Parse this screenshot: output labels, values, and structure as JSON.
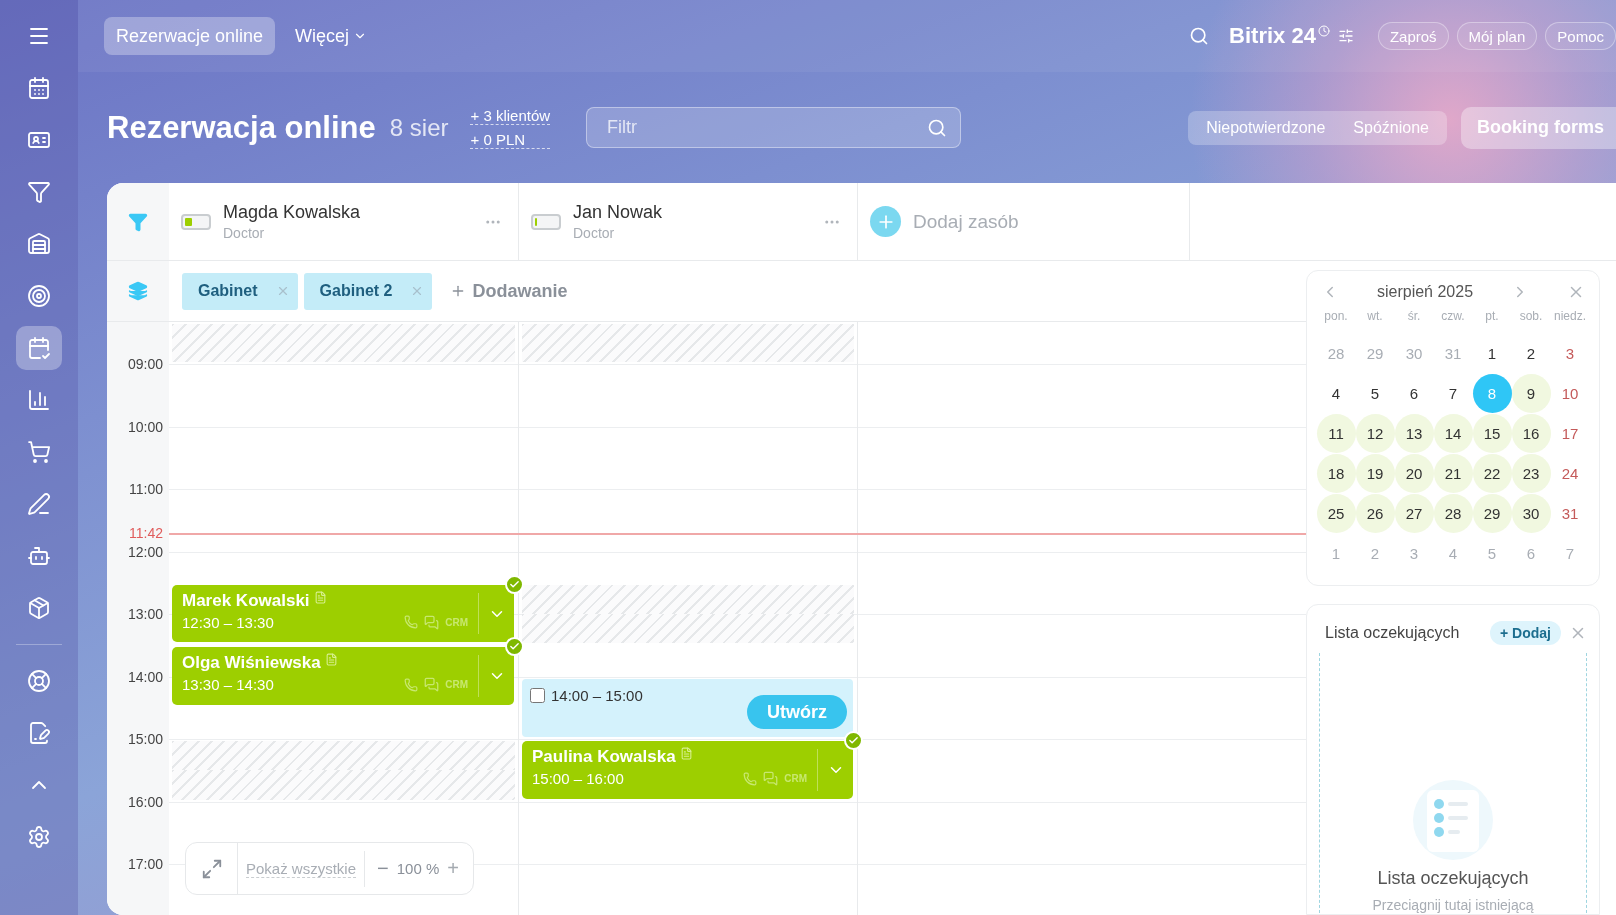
{
  "sidebar": {
    "items": [
      {
        "selected": false
      },
      {
        "selected": false
      },
      {
        "selected": false
      },
      {
        "selected": false
      },
      {
        "selected": false
      },
      {
        "selected": false
      },
      {
        "selected": true
      },
      {
        "selected": false
      },
      {
        "selected": false
      },
      {
        "selected": false
      },
      {
        "selected": false
      },
      {
        "selected": false
      },
      {
        "selected": false
      },
      {
        "selected": false
      },
      {
        "selected": false
      },
      {
        "selected": false
      }
    ]
  },
  "topbar": {
    "tabs": [
      {
        "label": "Rezerwacje online",
        "selected": true
      },
      {
        "label": "Więcej",
        "selected": false
      }
    ],
    "logo": "Bitrix 24",
    "buttons": [
      "Zaproś",
      "Mój plan",
      "Pomoc"
    ]
  },
  "header": {
    "title": "Rezerwacja online",
    "date": "8 sier",
    "stats": [
      "+ 3 klientów",
      "+ 0 PLN"
    ],
    "filter": {
      "placeholder": "Filtr"
    },
    "segments": [
      {
        "label": "Niepotwierdzone",
        "selected": false
      },
      {
        "label": "Spóźnione",
        "selected": false
      }
    ],
    "forms_button": "Booking forms"
  },
  "resources": [
    {
      "name": "Magda Kowalska",
      "role": "Doctor",
      "level": 0.3,
      "slots": [
        {
          "blocked": true
        },
        {
          "blocked": false
        },
        {
          "blocked": false
        },
        {
          "blocked": false
        },
        {
          "blocked": false
        },
        {
          "blocked": false
        },
        {
          "blocked": false
        },
        {
          "blocked": false
        },
        {
          "blocked": false
        },
        {
          "blocked": false
        },
        {
          "blocked": false
        },
        {
          "blocked": false
        },
        {
          "blocked": false
        },
        {
          "blocked": true
        },
        {
          "blocked": true
        },
        {
          "blocked": false
        },
        {
          "blocked": false
        },
        {
          "blocked": false
        },
        {
          "blocked": false
        }
      ],
      "events": [
        {
          "kind": "booking",
          "name": "Marek Kowalski",
          "time": "12:30 – 13:30",
          "crm": "CRM",
          "confirmed": true
        },
        {
          "kind": "booking",
          "name": "Olga Wiśniewska",
          "time": "13:30 – 14:30",
          "crm": "CRM",
          "confirmed": true
        }
      ]
    },
    {
      "name": "Jan Nowak",
      "role": "Doctor",
      "level": 0.08,
      "slots": [
        {
          "blocked": true
        },
        {
          "blocked": false
        },
        {
          "blocked": false
        },
        {
          "blocked": false
        },
        {
          "blocked": false
        },
        {
          "blocked": false
        },
        {
          "blocked": false
        },
        {
          "blocked": false
        },
        {
          "blocked": true
        },
        {
          "blocked": true
        },
        {
          "blocked": false
        },
        {
          "blocked": false
        },
        {
          "blocked": false
        },
        {
          "blocked": false
        },
        {
          "blocked": false
        },
        {
          "blocked": false
        },
        {
          "blocked": false
        },
        {
          "blocked": false
        },
        {
          "blocked": false
        }
      ],
      "events": [
        {
          "kind": "draft",
          "time": "14:00 – 15:00",
          "checked": false,
          "action": "Utwórz"
        },
        {
          "kind": "booking",
          "name": "Paulina Kowalska",
          "time": "15:00 – 16:00",
          "crm": "CRM",
          "confirmed": true
        }
      ]
    }
  ],
  "add_resource": "Dodaj zasób",
  "tags": [
    "Gabinet",
    "Gabinet 2"
  ],
  "add_tag": "Dodawanie",
  "hours": [
    "09:00",
    "10:00",
    "11:00",
    "12:00",
    "13:00",
    "14:00",
    "15:00",
    "16:00",
    "17:00"
  ],
  "now": "11:42",
  "zoom": {
    "show_all": "Pokaż wszystkie",
    "minus": "−",
    "value": "100 %",
    "plus": "+"
  },
  "calendar": {
    "month": "sierpień 2025",
    "weekdays": [
      "pon.",
      "wt.",
      "śr.",
      "czw.",
      "pt.",
      "sob.",
      "niedz."
    ],
    "weeks": [
      [
        {
          "label": "28",
          "kind": "other",
          "available": false,
          "selected": false
        },
        {
          "label": "29",
          "kind": "other",
          "available": false,
          "selected": false
        },
        {
          "label": "30",
          "kind": "other",
          "available": false,
          "selected": false
        },
        {
          "label": "31",
          "kind": "other",
          "available": false,
          "selected": false
        },
        {
          "label": "1",
          "kind": "day",
          "available": false,
          "selected": false
        },
        {
          "label": "2",
          "kind": "day",
          "available": false,
          "selected": false
        },
        {
          "label": "3",
          "kind": "sunday",
          "available": false,
          "selected": false
        }
      ],
      [
        {
          "label": "4",
          "kind": "day",
          "available": false,
          "selected": false
        },
        {
          "label": "5",
          "kind": "day",
          "available": false,
          "selected": false
        },
        {
          "label": "6",
          "kind": "day",
          "available": false,
          "selected": false
        },
        {
          "label": "7",
          "kind": "day",
          "available": false,
          "selected": false
        },
        {
          "label": "8",
          "kind": "day",
          "available": false,
          "selected": true
        },
        {
          "label": "9",
          "kind": "day",
          "available": true,
          "selected": false
        },
        {
          "label": "10",
          "kind": "sunday",
          "available": false,
          "selected": false
        }
      ],
      [
        {
          "label": "11",
          "kind": "day",
          "available": true,
          "selected": false
        },
        {
          "label": "12",
          "kind": "day",
          "available": true,
          "selected": false
        },
        {
          "label": "13",
          "kind": "day",
          "available": true,
          "selected": false
        },
        {
          "label": "14",
          "kind": "day",
          "available": true,
          "selected": false
        },
        {
          "label": "15",
          "kind": "day",
          "available": true,
          "selected": false
        },
        {
          "label": "16",
          "kind": "day",
          "available": true,
          "selected": false
        },
        {
          "label": "17",
          "kind": "sunday",
          "available": false,
          "selected": false
        }
      ],
      [
        {
          "label": "18",
          "kind": "day",
          "available": true,
          "selected": false
        },
        {
          "label": "19",
          "kind": "day",
          "available": true,
          "selected": false
        },
        {
          "label": "20",
          "kind": "day",
          "available": true,
          "selected": false
        },
        {
          "label": "21",
          "kind": "day",
          "available": true,
          "selected": false
        },
        {
          "label": "22",
          "kind": "day",
          "available": true,
          "selected": false
        },
        {
          "label": "23",
          "kind": "day",
          "available": true,
          "selected": false
        },
        {
          "label": "24",
          "kind": "sunday",
          "available": false,
          "selected": false
        }
      ],
      [
        {
          "label": "25",
          "kind": "day",
          "available": true,
          "selected": false
        },
        {
          "label": "26",
          "kind": "day",
          "available": true,
          "selected": false
        },
        {
          "label": "27",
          "kind": "day",
          "available": true,
          "selected": false
        },
        {
          "label": "28",
          "kind": "day",
          "available": true,
          "selected": false
        },
        {
          "label": "29",
          "kind": "day",
          "available": true,
          "selected": false
        },
        {
          "label": "30",
          "kind": "day",
          "available": true,
          "selected": false
        },
        {
          "label": "31",
          "kind": "sunday",
          "available": false,
          "selected": false
        }
      ],
      [
        {
          "label": "1",
          "kind": "other",
          "available": false,
          "selected": false
        },
        {
          "label": "2",
          "kind": "other",
          "available": false,
          "selected": false
        },
        {
          "label": "3",
          "kind": "other",
          "available": false,
          "selected": false
        },
        {
          "label": "4",
          "kind": "other",
          "available": false,
          "selected": false
        },
        {
          "label": "5",
          "kind": "other",
          "available": false,
          "selected": false
        },
        {
          "label": "6",
          "kind": "other",
          "available": false,
          "selected": false
        },
        {
          "label": "7",
          "kind": "other",
          "available": false,
          "selected": false
        }
      ]
    ]
  },
  "waitlist": {
    "title": "Lista oczekujących",
    "add": "+ Dodaj",
    "empty_title": "Lista oczekujących",
    "empty_text": "Przeciągnij tutaj istniejącą"
  }
}
